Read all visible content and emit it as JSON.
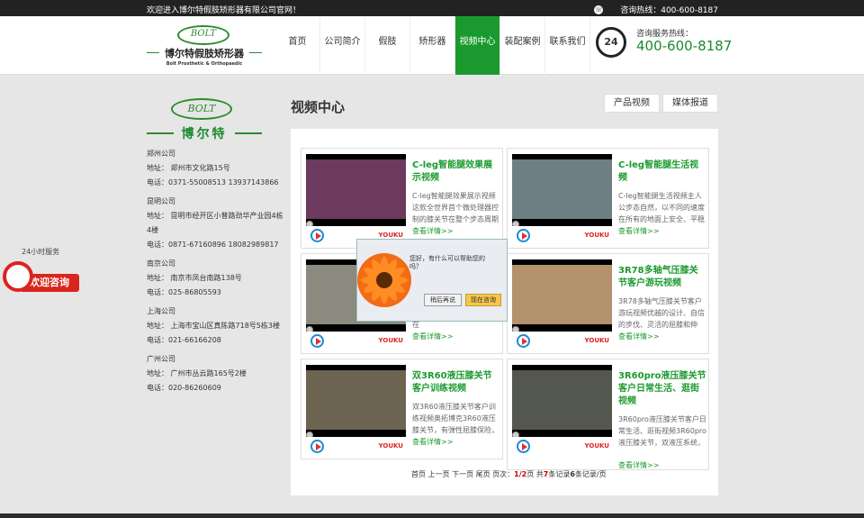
{
  "topbar": {
    "welcome": "欢迎进入博尔特假肢矫形器有限公司官网！",
    "hotline_label": "咨询热线：400-600-8187"
  },
  "logo": {
    "mark": "BOLT",
    "cn": "博尔特假肢矫形器",
    "en": "Bolt Prosthetic & Orthopaedic"
  },
  "nav": {
    "items": [
      "首页",
      "公司简介",
      "假肢",
      "矫形器",
      "视频中心",
      "装配案例",
      "联系我们"
    ],
    "active_index": 4
  },
  "hotbox": {
    "badge": "24",
    "label": "咨询服务热线：",
    "number": "400-600-8187"
  },
  "sidebar": {
    "logo_mark": "BOLT",
    "logo_cn": "博尔特",
    "offices": [
      {
        "name": "郑州公司",
        "addr": "地址： 郑州市文化路15号",
        "tel": "电话：0371-55008513 13937143866"
      },
      {
        "name": "昆明公司",
        "addr": "地址： 昆明市经开区小普路劲华产业园4栋4楼",
        "tel": "电话：0871-67160896 18082989817"
      },
      {
        "name": "南京公司",
        "addr": "地址： 南京市凤台南路138号",
        "tel": "电话：025-86805593"
      },
      {
        "name": "上海公司",
        "addr": "地址： 上海市宝山区真陈路718号5栋3楼",
        "tel": "电话：021-66166208"
      },
      {
        "name": "广州公司",
        "addr": "地址： 广州市丛云路165号2楼",
        "tel": "电话：020-86260609"
      }
    ]
  },
  "consult": {
    "tag": "24小时服务",
    "banner": "欢迎咨询"
  },
  "main": {
    "title": "视频中心",
    "tabs": [
      "产品视频",
      "媒体报道"
    ]
  },
  "cards": [
    {
      "title": "C-leg智能腿效果展示视频",
      "desc": "C-leg智能腿效果展示视频 这款全世界首个微处理器控制的膝关节在整个步态周期",
      "more": "查看详情>>",
      "logo": "YOUKU",
      "screen": "#6b3a5c"
    },
    {
      "title": "C-leg智能腿生活视频",
      "desc": "C-leg智能腿生活视频主人公步态自然，以不同的速度在所有的地面上安全、平稳",
      "more": "查看详情>>",
      "logo": "YOUKU",
      "screen": "#6e7f83"
    },
    {
      "title": "",
      "desc": "奥拓博克3R80回转液压假肢膝关节，获得专利的功能在",
      "more": "查看详情>>",
      "logo": "YOUKU",
      "screen": "#8a8a7e"
    },
    {
      "title": "3R78多轴气压膝关节客户游玩视频",
      "desc": "3R78多轴气压膝关节客户游玩视频优越的设计、自信的步伐、灵活的屈膝和伸展，",
      "more": "查看详情>>",
      "logo": "YOUKU",
      "screen": "#b3926d"
    },
    {
      "title": "双3R60液压膝关节客户训练视频",
      "desc": "双3R60液压膝关节客户训练视频奥拓博克3R60液压膝关节，有弹性屈膝保险，脚跟",
      "more": "查看详情>>",
      "logo": "YOUKU",
      "screen": "#6e6452"
    },
    {
      "title": "3R60pro液压膝关节客户日常生活、逛街视频",
      "desc": "3R60pro液压膝关节客户日常生活、逛街视频3R60pro液压膝关节，双液压系统，",
      "more": "查看详情>>",
      "logo": "YOUKU",
      "screen": "#54574e"
    }
  ],
  "pager": {
    "text_before": "首页 上一页 下一页 尾页 页次：",
    "current": "1/2",
    "text_mid": "页 共",
    "total": "7",
    "text_mid2": "条记录",
    "per": "6",
    "text_after": "条记录/页"
  },
  "popup": {
    "message": "您好，有什么可以帮助您的吗？",
    "later": "稍后再说",
    "now": "现在咨询"
  }
}
